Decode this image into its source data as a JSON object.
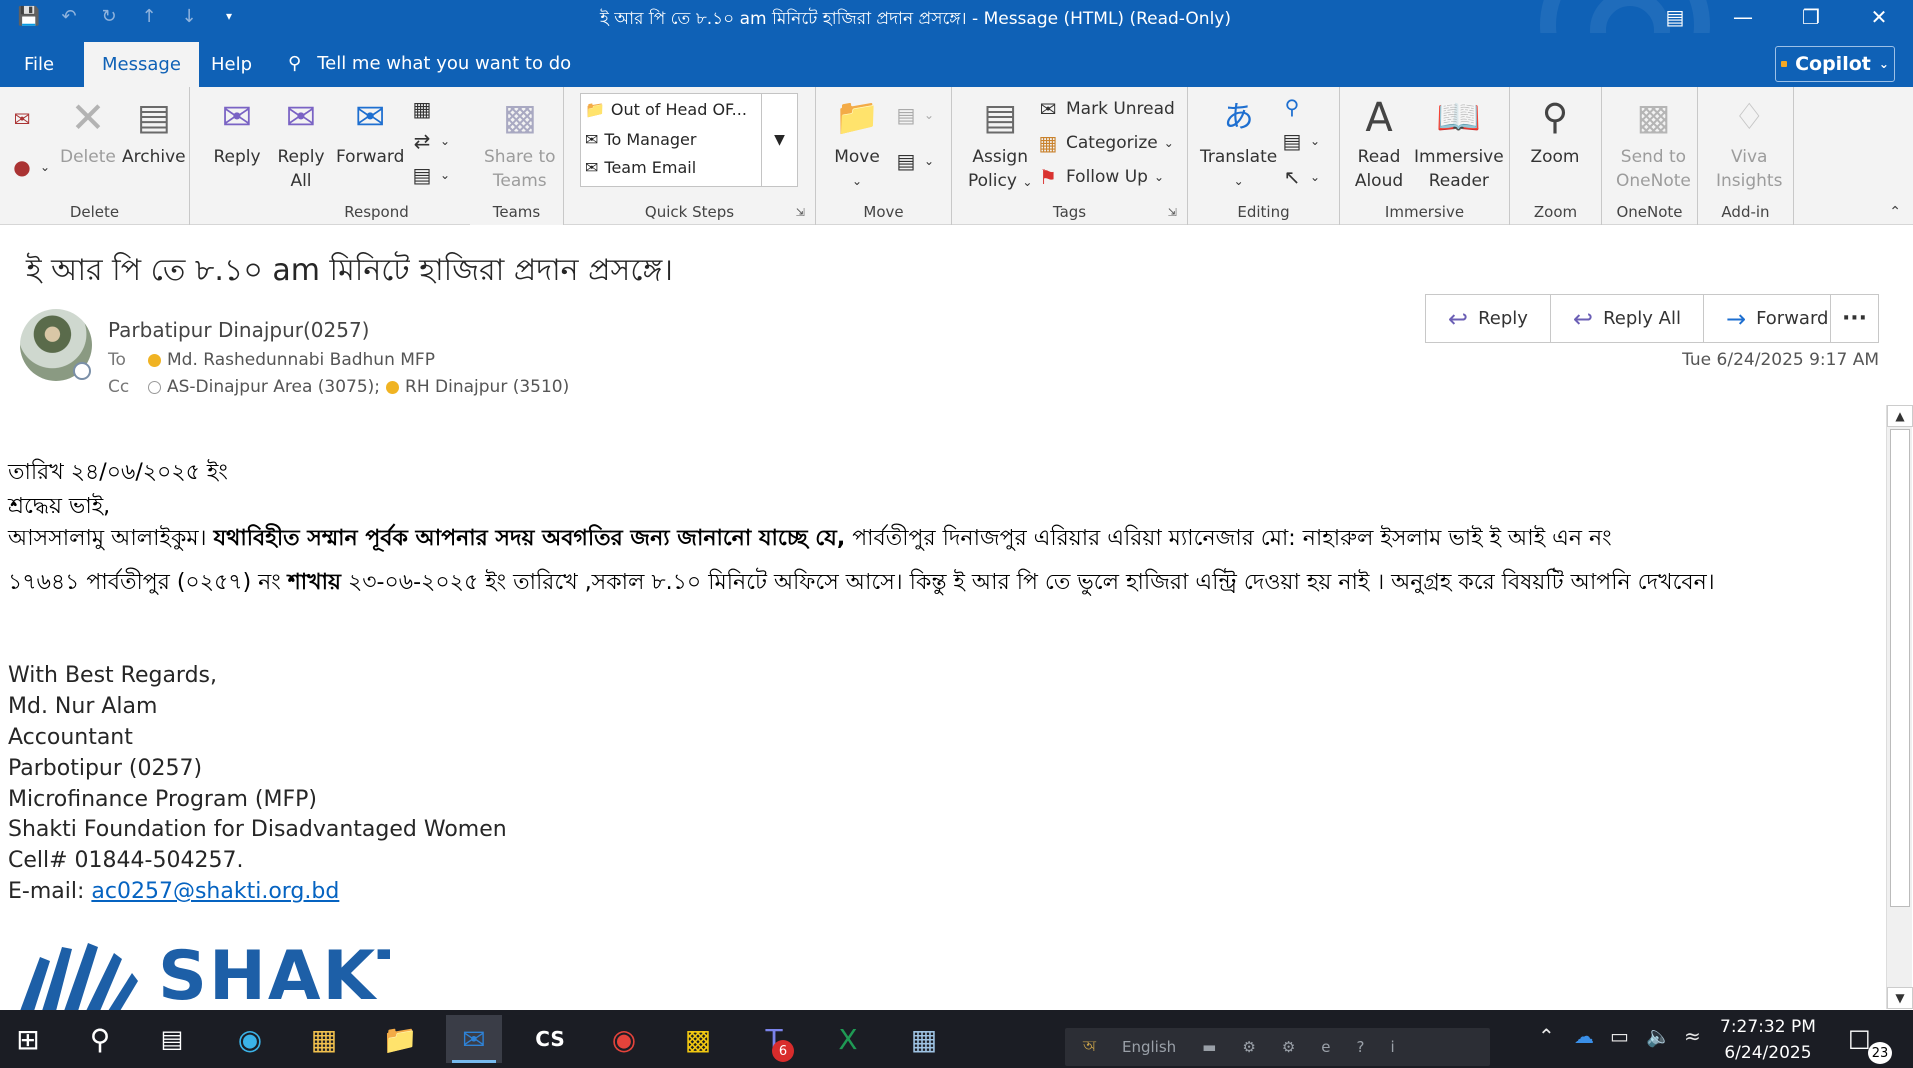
{
  "window": {
    "title": "ই আর পি তে ৮.১০  am  মিনিটে  হাজিরা প্রদান প্রসঙ্গে।  -  Message (HTML) (Read-Only)"
  },
  "menu": {
    "tabs": [
      {
        "label": "File"
      },
      {
        "label": "Message"
      },
      {
        "label": "Help"
      }
    ],
    "tell_me": "Tell me what you want to do",
    "copilot": "Copilot"
  },
  "ribbon": {
    "delete_group": {
      "label": "Delete",
      "delete": "Delete",
      "archive": "Archive"
    },
    "respond_group": {
      "label": "Respond",
      "reply": "Reply",
      "reply_all_1": "Reply",
      "reply_all_2": "All",
      "forward": "Forward"
    },
    "teams_group": {
      "label": "Teams",
      "share_1": "Share to",
      "share_2": "Teams"
    },
    "quick_steps_group": {
      "label": "Quick Steps",
      "items": [
        "Out of Head OF...",
        "To Manager",
        "Team Email"
      ]
    },
    "move_group": {
      "label": "Move",
      "move": "Move"
    },
    "tags_group": {
      "label": "Tags",
      "assign_1": "Assign",
      "assign_2": "Policy",
      "mark_unread": "Mark Unread",
      "categorize": "Categorize",
      "follow_up": "Follow Up"
    },
    "editing_group": {
      "label": "Editing",
      "translate": "Translate"
    },
    "immersive_group": {
      "label": "Immersive",
      "read_1": "Read",
      "read_2": "Aloud",
      "immersive_1": "Immersive",
      "immersive_2": "Reader"
    },
    "zoom_group": {
      "label": "Zoom",
      "zoom": "Zoom"
    },
    "onenote_group": {
      "label": "OneNote",
      "send_1": "Send to",
      "send_2": "OneNote"
    },
    "addin_group": {
      "label": "Add-in",
      "viva_1": "Viva",
      "viva_2": "Insights"
    }
  },
  "message": {
    "subject": "ই আর পি তে ৮.১০  am  মিনিটে  হাজিরা প্রদান প্রসঙ্গে।",
    "sender": "Parbatipur Dinajpur(0257)",
    "to_label": "To",
    "to": "Md. Rashedunnabi Badhun MFP",
    "cc_label": "Cc",
    "cc_1": "AS-Dinajpur Area (3075);",
    "cc_2": "RH Dinajpur (3510)",
    "date": "Tue 6/24/2025 9:17 AM",
    "actions": {
      "reply": "Reply",
      "reply_all": "Reply All",
      "forward": "Forward"
    },
    "body": {
      "line1": "তারিখ ২৪/০৬/২০২৫ ইং",
      "line2": "শ্রদ্ধেয়  ভাই,",
      "line3_start": "আসসালামু  আলাইকুম।  ",
      "line3_bold": "যথাবিহীত সম্মান পূর্বক আপনার সদয় অবগতির জন্য জানানো যাচ্ছে যে,",
      "line3_end": " পার্বতীপুর দিনাজপুর এরিয়ার এরিয়া ম্যানেজার  মো: নাহারুল  ইসলাম ভাই  ই আই এন নং",
      "line4_start": "১৭৬৪১  পার্বতীপুর  (০২৫৭)  নং  ",
      "line4_bold": "শাখায়",
      "line4_end": "  ২৩-০৬-২০২৫ ইং তারিখে  ,সকাল ৮.১০   মিনিটে  অফিসে আসে। কিন্তু ই  আর পি তে ভুলে হাজিরা এন্ট্রি দেওয়া হয় নাই  ।  অনুগ্রহ করে বিষয়টি আপনি দেখবেন।"
    },
    "signature": {
      "regards": "With Best Regards,",
      "name": "Md. Nur Alam",
      "role": "Accountant",
      "branch": "Parbotipur (0257)",
      "program": "Microfinance Program (MFP)",
      "org": "Shakti Foundation for Disadvantaged Women",
      "cell": "Cell# 01844-504257.",
      "email_label": "E-mail: ",
      "email": "ac0257@shakti.org.bd"
    },
    "logo_text": "SHAKTI"
  },
  "taskbar": {
    "badges": {
      "teams": "6",
      "notifications": "23"
    },
    "cs_label": "CS",
    "tray_language": "English",
    "time": "7:27:32 PM",
    "date": "6/24/2025"
  }
}
